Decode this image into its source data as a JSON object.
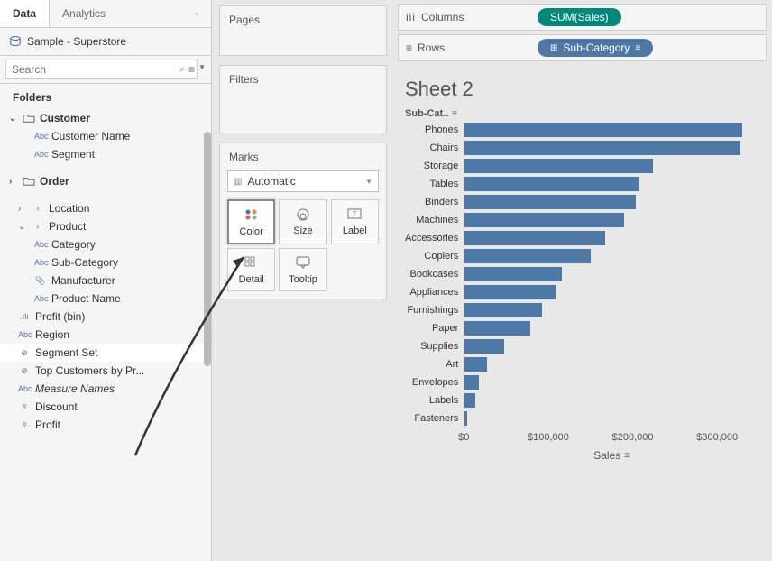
{
  "tabs": {
    "data": "Data",
    "analytics": "Analytics"
  },
  "datasource": "Sample - Superstore",
  "search": {
    "placeholder": "Search"
  },
  "folders_label": "Folders",
  "tree": {
    "customer": {
      "label": "Customer",
      "fields": [
        "Customer Name",
        "Segment"
      ]
    },
    "order": {
      "label": "Order"
    },
    "location": {
      "label": "Location"
    },
    "product": {
      "label": "Product",
      "fields": [
        "Category",
        "Sub-Category",
        "Manufacturer",
        "Product Name"
      ]
    },
    "profit_bin": "Profit (bin)",
    "region": "Region",
    "segment_set": "Segment Set",
    "top_customers": "Top Customers by Pr...",
    "measure_names": "Measure Names",
    "discount": "Discount",
    "profit": "Profit"
  },
  "cards": {
    "pages": "Pages",
    "filters": "Filters",
    "marks": "Marks"
  },
  "marks": {
    "type": "Automatic",
    "color": "Color",
    "size": "Size",
    "label": "Label",
    "detail": "Detail",
    "tooltip": "Tooltip"
  },
  "shelves": {
    "columns": "Columns",
    "rows": "Rows",
    "columns_pill": "SUM(Sales)",
    "rows_pill": "Sub-Category"
  },
  "sheet_title": "Sheet 2",
  "axis_header": "Sub-Cat..",
  "x_label": "Sales",
  "x_ticks": [
    "$0",
    "$100,000",
    "$200,000",
    "$300,000"
  ],
  "chart_data": {
    "type": "bar",
    "title": "Sheet 2",
    "xlabel": "Sales",
    "ylabel": "Sub-Category",
    "xlim": [
      0,
      350000
    ],
    "categories": [
      "Phones",
      "Chairs",
      "Storage",
      "Tables",
      "Binders",
      "Machines",
      "Accessories",
      "Copiers",
      "Bookcases",
      "Appliances",
      "Furnishings",
      "Paper",
      "Supplies",
      "Art",
      "Envelopes",
      "Labels",
      "Fasteners"
    ],
    "values": [
      330000,
      328000,
      224000,
      207000,
      203000,
      189000,
      167000,
      150000,
      115000,
      108000,
      92000,
      78000,
      47000,
      27000,
      17000,
      13000,
      3000
    ]
  }
}
